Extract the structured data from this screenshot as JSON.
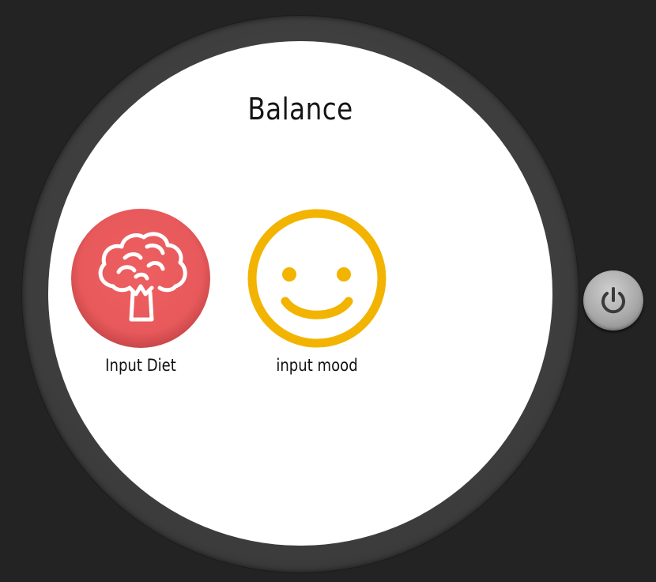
{
  "watch": {
    "title": "Balance",
    "apps": [
      {
        "label": "Input Diet",
        "icon": "broccoli-icon",
        "color": "#E8595B"
      },
      {
        "label": "input mood",
        "icon": "smiley-icon",
        "color": "#F2B400"
      }
    ],
    "power_button": {
      "icon": "power-icon"
    }
  },
  "colors": {
    "background": "#232323",
    "bezel": "#3c3c3c",
    "screen": "#FFFFFF",
    "diet_accent": "#E8595B",
    "mood_accent": "#F2B400"
  }
}
